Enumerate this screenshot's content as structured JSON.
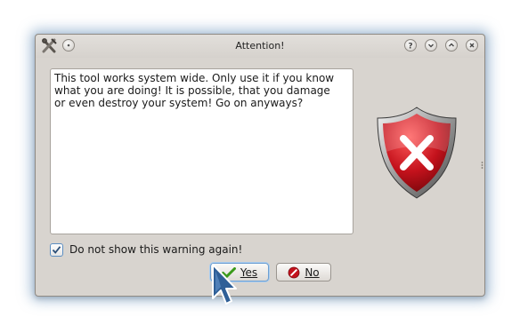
{
  "window": {
    "title": "Attention!",
    "app_icon": "tools-icon",
    "title_buttons": [
      "help-icon",
      "minimize-icon",
      "maximize-icon",
      "close-icon"
    ]
  },
  "message": {
    "text": "This tool works system wide. Only use it if you know\nwhat you are doing! It is possible, that you damage\nor even destroy your system! Go on anyways?"
  },
  "warning_icon": "shield-error-icon",
  "checkbox": {
    "label": "Do not show this warning again!",
    "checked": true
  },
  "buttons": {
    "yes": {
      "label": "Yes",
      "icon": "checkmark-icon"
    },
    "no": {
      "label": "No",
      "icon": "cancel-icon"
    }
  },
  "colors": {
    "window_bg": "#d8d4cf",
    "shield_red": "#c4121c",
    "yes_check": "#3a9a1a",
    "focus_blue": "#6d9fd2"
  }
}
